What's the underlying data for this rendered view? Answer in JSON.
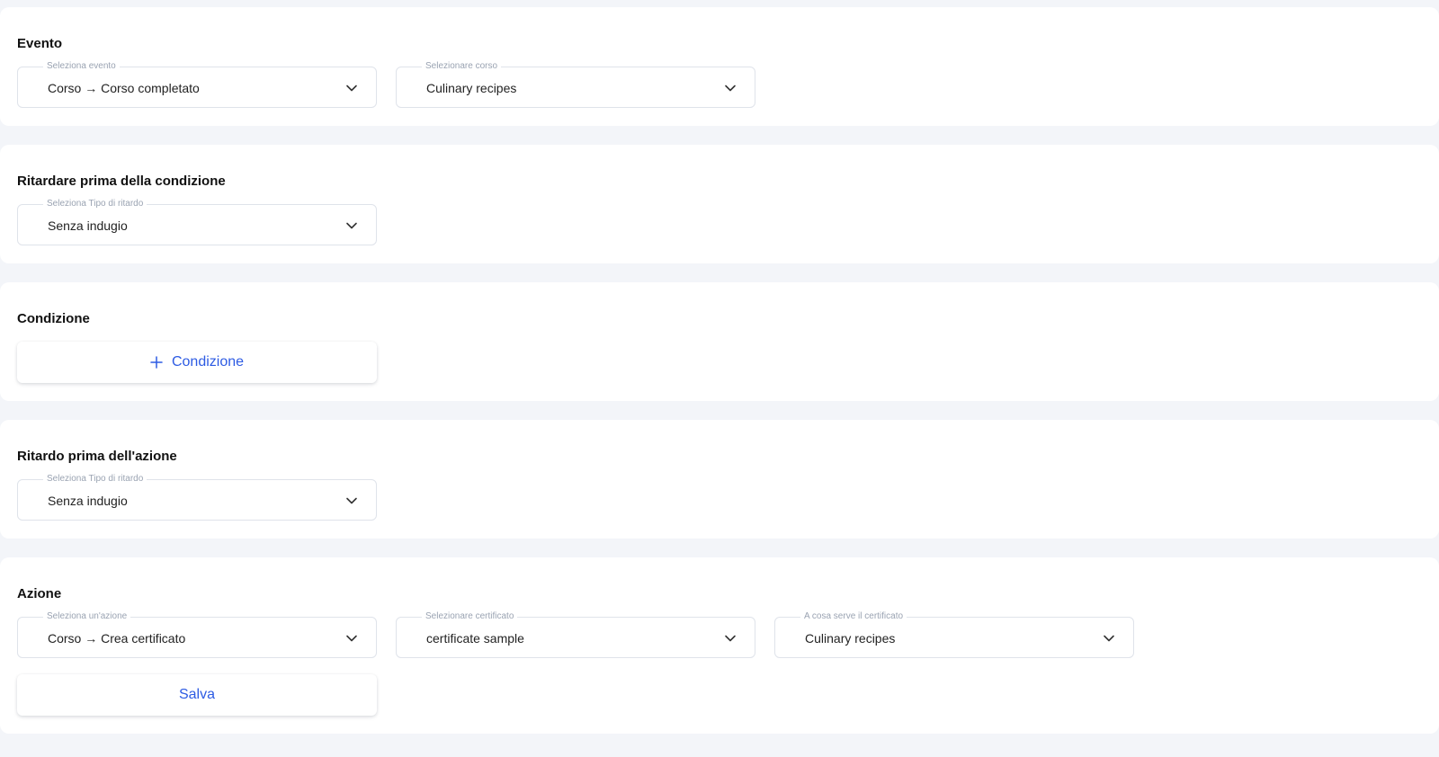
{
  "sections": {
    "evento": {
      "title": "Evento",
      "event_select": {
        "label": "Seleziona evento",
        "value": "Corso → Corso completato"
      },
      "course_select": {
        "label": "Selezionare corso",
        "value": "Culinary recipes"
      }
    },
    "delay_before_condition": {
      "title": "Ritardare prima della condizione",
      "delay_select": {
        "label": "Seleziona Tipo di ritardo",
        "value": "Senza indugio"
      }
    },
    "condizione": {
      "title": "Condizione",
      "add_button_label": "Condizione"
    },
    "delay_before_action": {
      "title": "Ritardo prima dell'azione",
      "delay_select": {
        "label": "Seleziona Tipo di ritardo",
        "value": "Senza indugio"
      }
    },
    "azione": {
      "title": "Azione",
      "action_select": {
        "label": "Seleziona un'azione",
        "value": "Corso → Crea certificato"
      },
      "certificate_select": {
        "label": "Selezionare certificato",
        "value": "certificate sample"
      },
      "certificate_for_select": {
        "label": "A cosa serve il certificato",
        "value": "Culinary recipes"
      },
      "save_button_label": "Salva"
    }
  },
  "icons": {
    "dropdown": "chevron-down-icon",
    "add": "plus-icon"
  },
  "colors": {
    "background": "#f3f5f9",
    "card": "#ffffff",
    "accent": "#2d5be3",
    "border": "#dfe3ea",
    "label": "#9aa3b2"
  }
}
